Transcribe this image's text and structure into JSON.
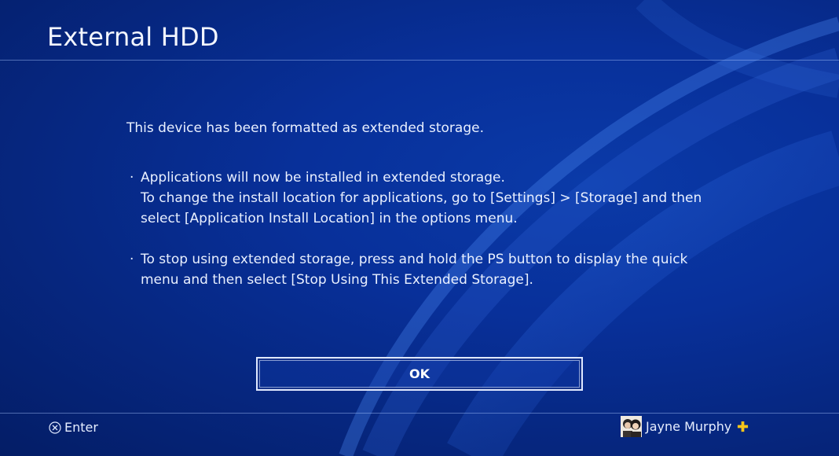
{
  "header": {
    "title": "External HDD"
  },
  "dialog": {
    "intro": "This device has been formatted as extended storage.",
    "bullet_marker": "·",
    "bullets": [
      {
        "lines": [
          "Applications will now be installed in extended storage.",
          "To change the install location for applications, go to [Settings] > [Storage] and then",
          "select [Application Install Location] in the options menu."
        ]
      },
      {
        "lines": [
          "To stop using extended storage, press and hold the PS button to display the quick",
          "menu and then select [Stop Using This Extended Storage]."
        ]
      }
    ],
    "ok_label": "OK"
  },
  "footer": {
    "enter_label": "Enter",
    "enter_icon": "cross-button-icon",
    "user_name": "Jayne Murphy",
    "user_avatar": "avatar",
    "plus_icon": "playstation-plus-icon"
  },
  "colors": {
    "background": "#062781",
    "text": "#e9f0ff",
    "divider": "#aac8ff",
    "plus": "#f7c51a"
  }
}
